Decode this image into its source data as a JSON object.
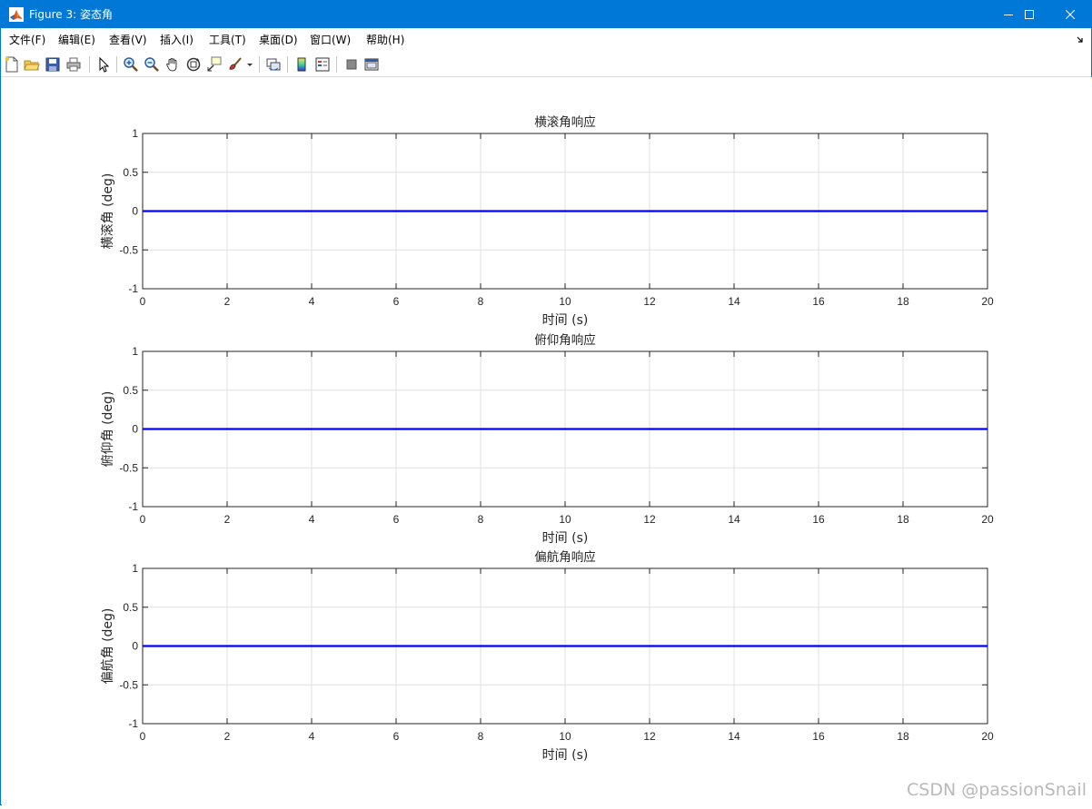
{
  "window": {
    "title": "Figure 3: 姿态角",
    "minimize_icon": "minimize-icon",
    "maximize_icon": "maximize-icon",
    "close_icon": "close-icon"
  },
  "menu": {
    "items": [
      "文件(F)",
      "编辑(E)",
      "查看(V)",
      "插入(I)",
      "工具(T)",
      "桌面(D)",
      "窗口(W)",
      "帮助(H)"
    ]
  },
  "toolbar": {
    "icons": [
      "new-figure-icon",
      "open-file-icon",
      "save-icon",
      "print-icon",
      "pointer-icon",
      "zoom-in-icon",
      "zoom-out-icon",
      "pan-hand-icon",
      "rotate-3d-icon",
      "data-cursor-icon",
      "brush-icon",
      "link-plot-icon",
      "colorbar-icon",
      "legend-icon",
      "hide-plot-tools-icon",
      "show-plot-tools-icon"
    ]
  },
  "colors": {
    "titlebar": "#0078d7",
    "line": "#0000ff",
    "grid": "#e0e0e0"
  },
  "chart_data": [
    {
      "type": "line",
      "title": "横滚角响应",
      "xlabel": "时间 (s)",
      "ylabel": "横滚角 (deg)",
      "xlim": [
        0,
        20
      ],
      "ylim": [
        -1,
        1
      ],
      "xticks": [
        0,
        2,
        4,
        6,
        8,
        10,
        12,
        14,
        16,
        18,
        20
      ],
      "yticks": [
        1,
        0.5,
        0,
        -0.5,
        -1
      ],
      "ytick_labels": [
        "1",
        "0.5",
        "0",
        "-0.5",
        "-1"
      ],
      "grid": true,
      "series": [
        {
          "x": [
            0,
            20
          ],
          "values": [
            0,
            0
          ]
        }
      ]
    },
    {
      "type": "line",
      "title": "俯仰角响应",
      "xlabel": "时间 (s)",
      "ylabel": "俯仰角 (deg)",
      "xlim": [
        0,
        20
      ],
      "ylim": [
        -1,
        1
      ],
      "xticks": [
        0,
        2,
        4,
        6,
        8,
        10,
        12,
        14,
        16,
        18,
        20
      ],
      "yticks": [
        1,
        0.5,
        0,
        -0.5,
        -1
      ],
      "ytick_labels": [
        "1",
        "0.5",
        "0",
        "-0.5",
        "-1"
      ],
      "grid": true,
      "series": [
        {
          "x": [
            0,
            20
          ],
          "values": [
            0,
            0
          ]
        }
      ]
    },
    {
      "type": "line",
      "title": "偏航角响应",
      "xlabel": "时间 (s)",
      "ylabel": "偏航角 (deg)",
      "xlim": [
        0,
        20
      ],
      "ylim": [
        -1,
        1
      ],
      "xticks": [
        0,
        2,
        4,
        6,
        8,
        10,
        12,
        14,
        16,
        18,
        20
      ],
      "yticks": [
        1,
        0.5,
        0,
        -0.5,
        -1
      ],
      "ytick_labels": [
        "1",
        "0.5",
        "0",
        "-0.5",
        "-1"
      ],
      "grid": true,
      "series": [
        {
          "x": [
            0,
            20
          ],
          "values": [
            0,
            0
          ]
        }
      ]
    }
  ],
  "watermark": "CSDN @passionSnail"
}
